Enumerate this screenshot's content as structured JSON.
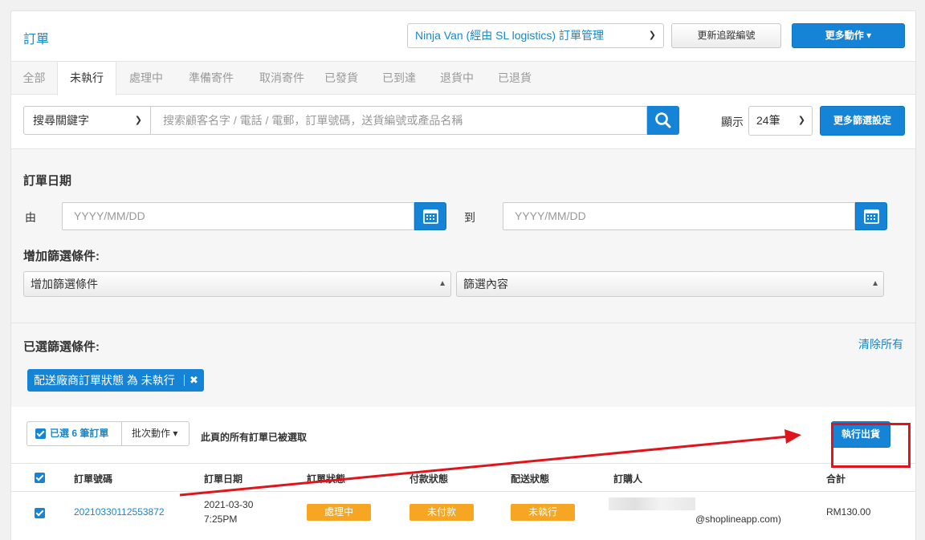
{
  "header": {
    "title": "訂單",
    "provider_select": "Ninja Van (經由 SL logistics) 訂單管理",
    "update_tracking_button": "更新追蹤編號",
    "more_actions_button": "更多動作"
  },
  "tabs": [
    {
      "label": "全部"
    },
    {
      "label": "未執行"
    },
    {
      "label": "處理中"
    },
    {
      "label": "準備寄件"
    },
    {
      "label": "取消寄件"
    },
    {
      "label": "已發貨"
    },
    {
      "label": "已到達"
    },
    {
      "label": "退貨中"
    },
    {
      "label": "已退貨"
    }
  ],
  "search": {
    "keyword_select": "搜尋關鍵字",
    "placeholder": "搜索顧客名字 / 電話 / 電郵，訂單號碼，送貨編號或產品名稱",
    "show_label": "顯示",
    "page_size": "24筆",
    "more_filters_button": "更多篩選設定"
  },
  "filters": {
    "order_date_heading": "訂單日期",
    "from_label": "由",
    "to_label": "到",
    "date_placeholder": "YYYY/MM/DD",
    "add_condition_heading": "增加篩選條件:",
    "add_condition_select": "增加篩選條件",
    "filter_content_select": "篩選內容",
    "selected_heading": "已選篩選條件:",
    "clear_all": "清除所有",
    "tag": "配送廠商訂單狀態 為 未執行"
  },
  "bulk": {
    "selected": "已選 6 筆訂單",
    "batch_action": "批次動作",
    "note": "此頁的所有訂單已被選取",
    "execute_button": "執行出貨"
  },
  "table": {
    "headers": [
      "訂單號碼",
      "訂單日期",
      "訂單狀態",
      "付款狀態",
      "配送狀態",
      "訂購人",
      "合計"
    ],
    "rows": [
      {
        "order_no": "20210330112553872",
        "date": "2021-03-30",
        "time": "7:25PM",
        "order_status": "處理中",
        "payment_status": "未付款",
        "delivery_status": "未執行",
        "customer_email": "@shoplineapp.com)",
        "total": "RM130.00"
      }
    ]
  },
  "colors": {
    "primary": "#1684d6",
    "link": "#1a87c9",
    "badge": "#f7a623",
    "annotation_red": "#e0151b"
  }
}
